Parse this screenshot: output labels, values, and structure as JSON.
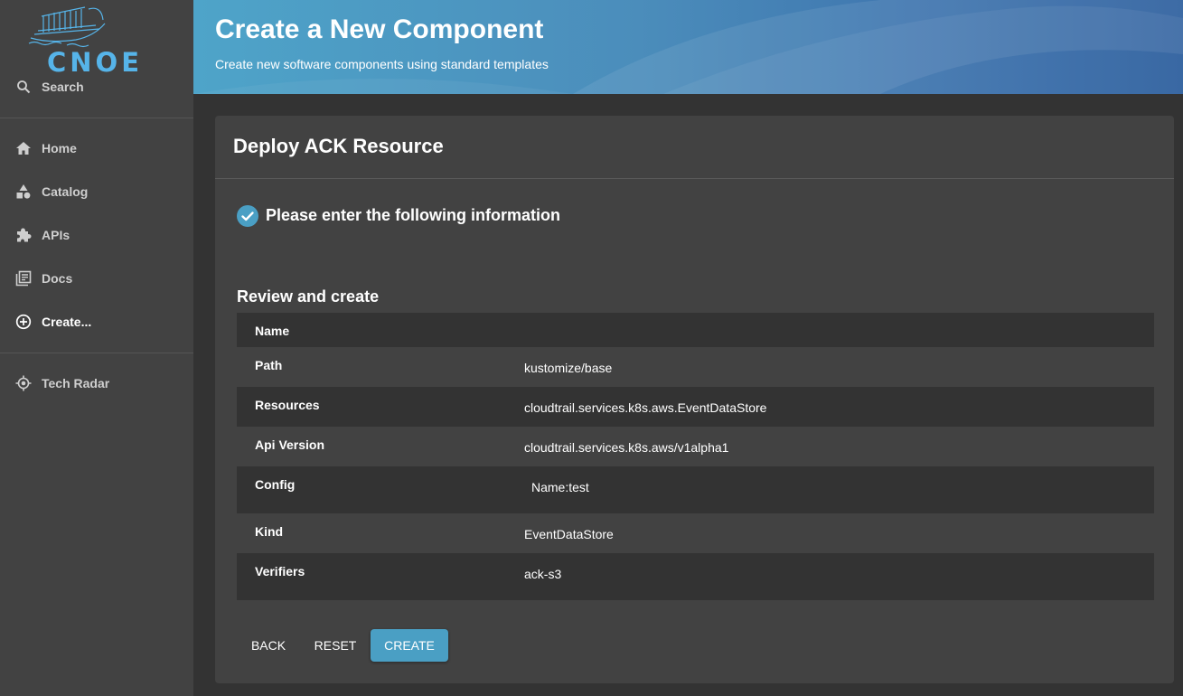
{
  "sidebar": {
    "logo_text": "CNOE",
    "search_label": "Search",
    "items": [
      {
        "label": "Home",
        "icon": "home-icon"
      },
      {
        "label": "Catalog",
        "icon": "catalog-icon"
      },
      {
        "label": "APIs",
        "icon": "puzzle-icon"
      },
      {
        "label": "Docs",
        "icon": "docs-icon"
      },
      {
        "label": "Create...",
        "icon": "add-circle-icon",
        "active": true
      }
    ],
    "tech_radar_label": "Tech Radar"
  },
  "header": {
    "title": "Create a New Component",
    "subtitle": "Create new software components using standard templates"
  },
  "card": {
    "title": "Deploy ACK Resource",
    "step_label": "Please enter the following information",
    "review_title": "Review and create",
    "rows": [
      {
        "key": "Name",
        "value": ""
      },
      {
        "key": "Path",
        "value": "kustomize/base"
      },
      {
        "key": "Resources",
        "value": "cloudtrail.services.k8s.aws.EventDataStore"
      },
      {
        "key": "Api Version",
        "value": "cloudtrail.services.k8s.aws/v1alpha1"
      },
      {
        "key": "Config",
        "value": "Name:test"
      },
      {
        "key": "Kind",
        "value": "EventDataStore"
      },
      {
        "key": "Verifiers",
        "value": "ack-s3"
      }
    ],
    "buttons": {
      "back": "BACK",
      "reset": "RESET",
      "create": "CREATE"
    }
  },
  "colors": {
    "accent": "#4a9fc4",
    "sidebar_bg": "#424242",
    "page_bg": "#333333",
    "logo": "#56b4e9"
  }
}
